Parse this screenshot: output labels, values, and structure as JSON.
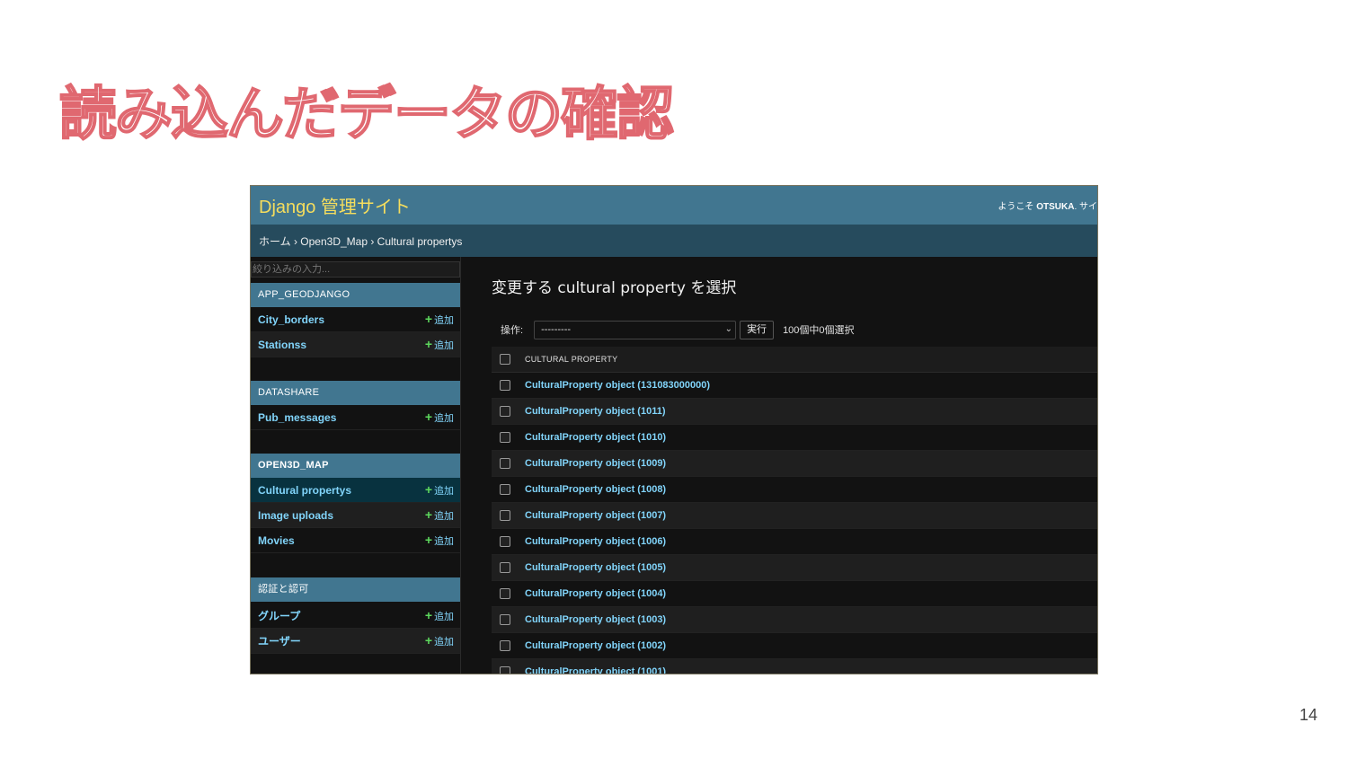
{
  "slide": {
    "title": "読み込んだデータの確認",
    "page_number": "14"
  },
  "header": {
    "brand": "Django 管理サイト",
    "welcome": "ようこそ",
    "username": "OTSUKA",
    "tools_rest": ". サイ"
  },
  "breadcrumb": "ホーム › Open3D_Map › Cultural propertys",
  "sidebar": {
    "filter_placeholder": "絞り込みの入力...",
    "add_label": "追加",
    "modules": [
      {
        "caption": "APP_GEODJANGO",
        "models": [
          "City_borders",
          "Stationss"
        ]
      },
      {
        "caption": "DATASHARE",
        "models": [
          "Pub_messages"
        ]
      },
      {
        "caption": "OPEN3D_MAP",
        "models": [
          "Cultural propertys",
          "Image uploads",
          "Movies"
        ]
      },
      {
        "caption": "認証と認可",
        "models": [
          "グループ",
          "ユーザー"
        ]
      }
    ]
  },
  "content": {
    "title": "変更する cultural property を選択",
    "action_label": "操作:",
    "action_selected": "---------",
    "go_label": "実行",
    "counter": "100個中0個選択",
    "column_header": "CULTURAL PROPERTY",
    "rows": [
      "CulturalProperty object (131083000000)",
      "CulturalProperty object (1011)",
      "CulturalProperty object (1010)",
      "CulturalProperty object (1009)",
      "CulturalProperty object (1008)",
      "CulturalProperty object (1007)",
      "CulturalProperty object (1006)",
      "CulturalProperty object (1005)",
      "CulturalProperty object (1004)",
      "CulturalProperty object (1003)",
      "CulturalProperty object (1002)",
      "CulturalProperty object (1001)"
    ]
  }
}
